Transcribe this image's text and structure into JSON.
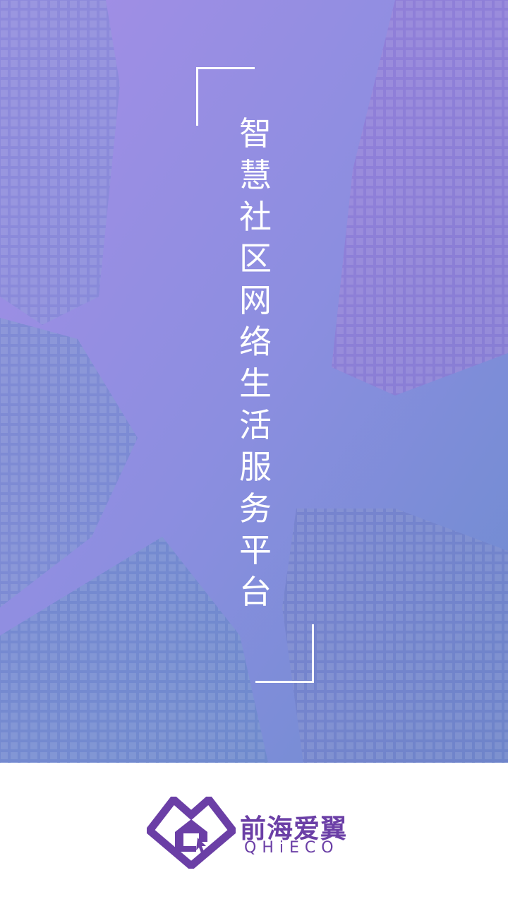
{
  "hero": {
    "tagline_chars": [
      "智",
      "慧",
      "社",
      "区",
      "网",
      "络",
      "生",
      "活",
      "服",
      "务",
      "平",
      "台"
    ]
  },
  "brand": {
    "name_cn": "前海爱翼",
    "name_en": "QHiECO",
    "logo_icon": "house-heart-logo-icon"
  },
  "colors": {
    "brand_purple": "#6b3fa6",
    "hero_top": "#9b8ee0",
    "hero_bottom": "#6a7fc2"
  }
}
